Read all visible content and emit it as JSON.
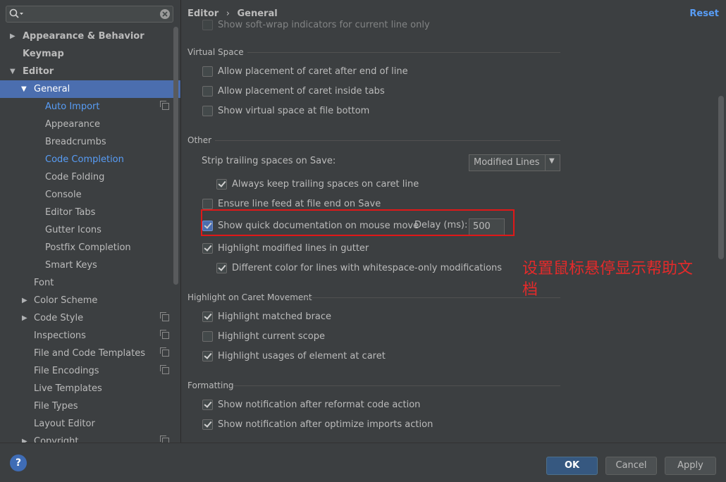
{
  "search": {
    "value": "",
    "placeholder": ""
  },
  "sidebar": {
    "items": [
      {
        "label": "Appearance & Behavior"
      },
      {
        "label": "Keymap"
      },
      {
        "label": "Editor"
      },
      {
        "label": "General"
      },
      {
        "label": "Auto Import"
      },
      {
        "label": "Appearance"
      },
      {
        "label": "Breadcrumbs"
      },
      {
        "label": "Code Completion"
      },
      {
        "label": "Code Folding"
      },
      {
        "label": "Console"
      },
      {
        "label": "Editor Tabs"
      },
      {
        "label": "Gutter Icons"
      },
      {
        "label": "Postfix Completion"
      },
      {
        "label": "Smart Keys"
      },
      {
        "label": "Font"
      },
      {
        "label": "Color Scheme"
      },
      {
        "label": "Code Style"
      },
      {
        "label": "Inspections"
      },
      {
        "label": "File and Code Templates"
      },
      {
        "label": "File Encodings"
      },
      {
        "label": "Live Templates"
      },
      {
        "label": "File Types"
      },
      {
        "label": "Layout Editor"
      },
      {
        "label": "Copyright"
      }
    ]
  },
  "header": {
    "breadcrumb_1": "Editor",
    "breadcrumb_sep": "›",
    "breadcrumb_2": "General",
    "reset": "Reset"
  },
  "partial_top": "Show soft-wrap indicators for current line only",
  "virtual_space": {
    "title": "Virtual Space",
    "items": [
      {
        "label": "Allow placement of caret after end of line",
        "checked": false
      },
      {
        "label": "Allow placement of caret inside tabs",
        "checked": false
      },
      {
        "label": "Show virtual space at file bottom",
        "checked": false
      }
    ]
  },
  "other": {
    "title": "Other",
    "strip_label": "Strip trailing spaces on Save:",
    "strip_value": "Modified Lines",
    "always_keep": {
      "label": "Always keep trailing spaces on caret line",
      "checked": true
    },
    "ensure_lf": {
      "label": "Ensure line feed at file end on Save",
      "checked": false
    },
    "quick_doc": {
      "label": "Show quick documentation on mouse move",
      "checked": true
    },
    "delay_label": "Delay (ms):",
    "delay_value": "500",
    "highlight_modified": {
      "label": "Highlight modified lines in gutter",
      "checked": true
    },
    "different_color": {
      "label": "Different color for lines with whitespace-only modifications",
      "checked": true
    }
  },
  "annotation": "设置鼠标悬停显示帮助文档",
  "caret_movement": {
    "title": "Highlight on Caret Movement",
    "items": [
      {
        "label": "Highlight matched brace",
        "checked": true
      },
      {
        "label": "Highlight current scope",
        "checked": false
      },
      {
        "label": "Highlight usages of element at caret",
        "checked": true
      }
    ]
  },
  "formatting": {
    "title": "Formatting",
    "items": [
      {
        "label": "Show notification after reformat code action",
        "checked": true
      },
      {
        "label": "Show notification after optimize imports action",
        "checked": true
      }
    ]
  },
  "buttons": {
    "ok": "OK",
    "cancel": "Cancel",
    "apply": "Apply",
    "help": "?"
  },
  "colors": {
    "accent": "#4b6eaf",
    "link": "#589df6",
    "annotation": "#e52a2a",
    "background": "#3c3f41"
  }
}
